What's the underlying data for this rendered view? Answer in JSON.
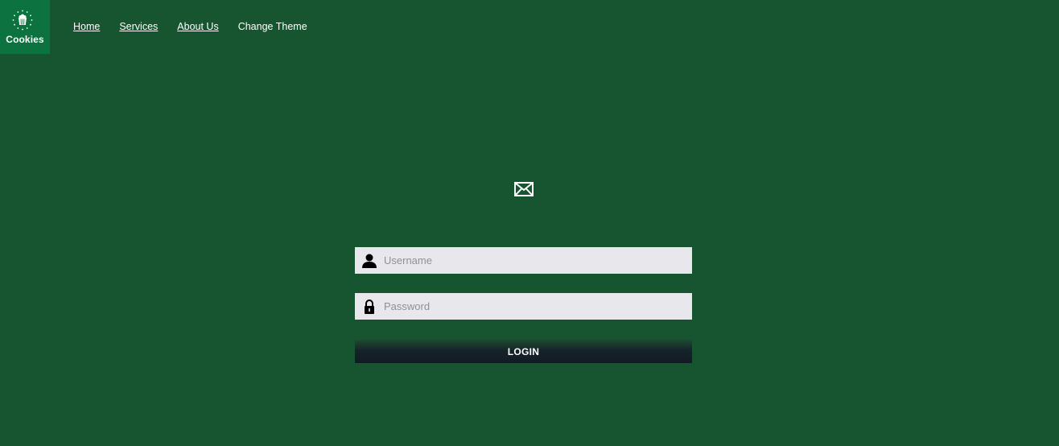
{
  "cookie_banner": {
    "label": "Cookies",
    "icon": "cookie-icon"
  },
  "nav": {
    "items": [
      {
        "label": "Home"
      },
      {
        "label": "Services"
      },
      {
        "label": "About Us"
      },
      {
        "label": "Change Theme"
      }
    ]
  },
  "login_form": {
    "header_icon": "mail-icon",
    "username": {
      "placeholder": "Username",
      "value": "",
      "icon": "user-icon"
    },
    "password": {
      "placeholder": "Password",
      "value": "",
      "icon": "lock-icon"
    },
    "submit_label": "LOGIN"
  },
  "colors": {
    "page_background": "#175530",
    "cookie_tile": "#0c7340",
    "input_background": "#e8e8ec",
    "button_dark": "#121b24"
  }
}
